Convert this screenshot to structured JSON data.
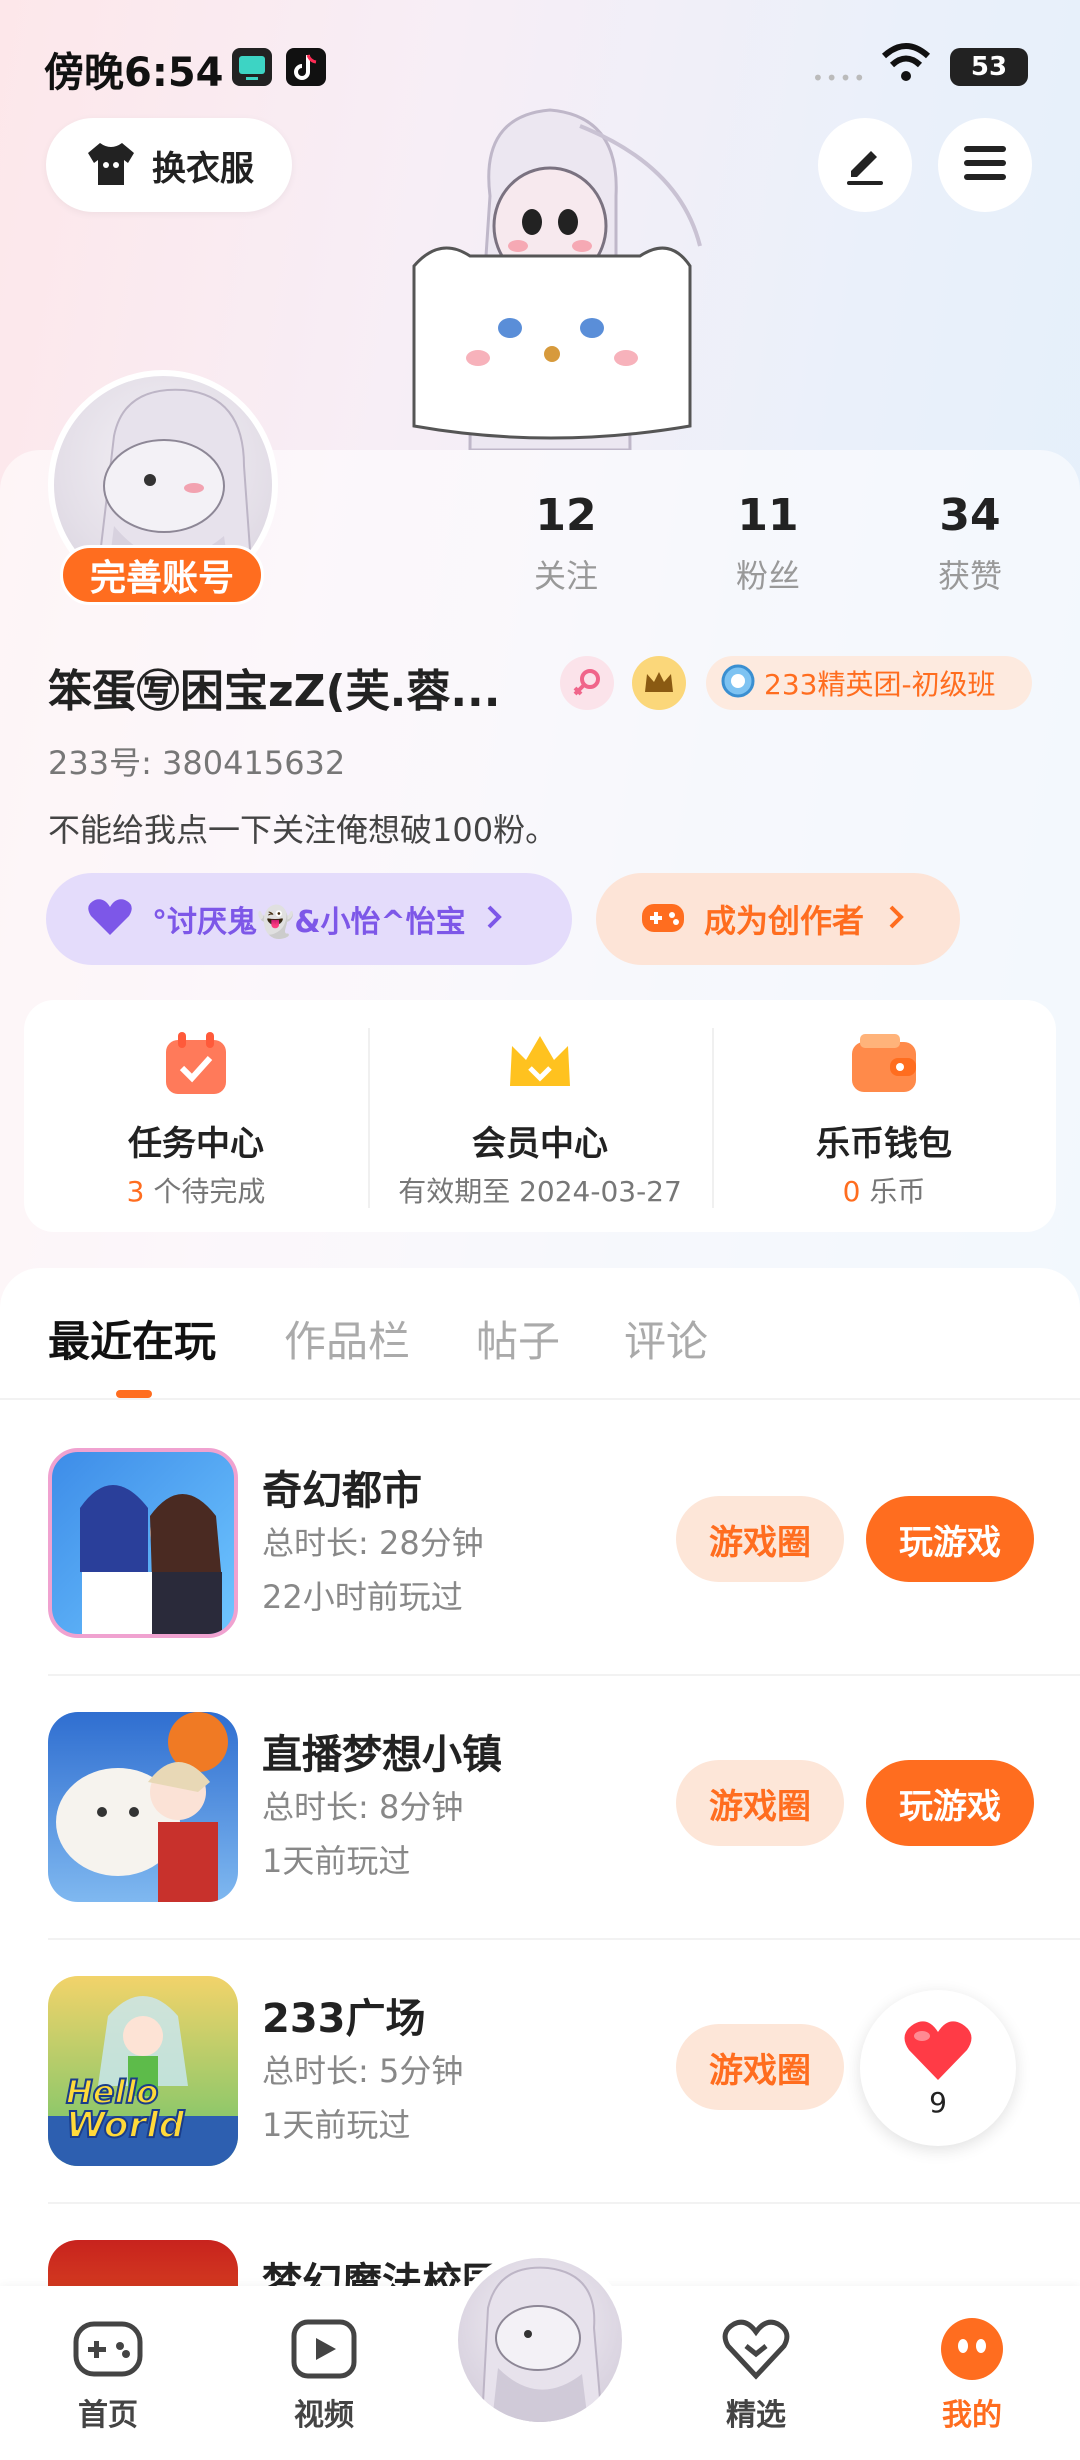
{
  "status_bar": {
    "time": "傍晚6:54",
    "battery": "53",
    "signal": "••••"
  },
  "header": {
    "outfit_label": "换衣服"
  },
  "profile": {
    "badge": "完善账号",
    "stats": [
      {
        "num": "12",
        "label": "关注"
      },
      {
        "num": "11",
        "label": "粉丝"
      },
      {
        "num": "34",
        "label": "获赞"
      }
    ],
    "name": "笨蛋㊢困宝zZ(芙.蓉...",
    "group_tag": "233精英团-初级班",
    "uid": "233号: 380415632",
    "bio": "不能给我点一下关注俺想破100粉。",
    "fan_pill": "°讨厌鬼👻&小怡^怡宝",
    "creator_pill": "成为创作者"
  },
  "quick": [
    {
      "title": "任务中心",
      "sub_num": "3",
      "sub_text": " 个待完成"
    },
    {
      "title": "会员中心",
      "sub_num": "",
      "sub_text": "有效期至 2024-03-27"
    },
    {
      "title": "乐币钱包",
      "sub_num": "0",
      "sub_text": " 乐币"
    }
  ],
  "tabs": [
    "最近在玩",
    "作品栏",
    "帖子",
    "评论"
  ],
  "games": [
    {
      "name": "奇幻都市",
      "duration": "总时长: 28分钟",
      "last": "22小时前玩过",
      "circle": "游戏圈",
      "play": "玩游戏"
    },
    {
      "name": "直播梦想小镇",
      "duration": "总时长: 8分钟",
      "last": "1天前玩过",
      "circle": "游戏圈",
      "play": "玩游戏"
    },
    {
      "name": "233广场",
      "duration": "总时长: 5分钟",
      "last": "1天前玩过",
      "circle": "游戏圈",
      "play": ""
    },
    {
      "name": "梦幻魔法校园",
      "duration": "",
      "last": "",
      "circle": "",
      "play": ""
    }
  ],
  "thumb_text": {
    "hello": "Hello",
    "world": "World"
  },
  "like_float": {
    "count": "9"
  },
  "nav": {
    "home": "首页",
    "video": "视频",
    "featured": "精选",
    "mine": "我的"
  },
  "colors": {
    "accent": "#ff6d1f",
    "accent_light": "#fde6d8",
    "purple_pill": "#e4dcfb"
  }
}
